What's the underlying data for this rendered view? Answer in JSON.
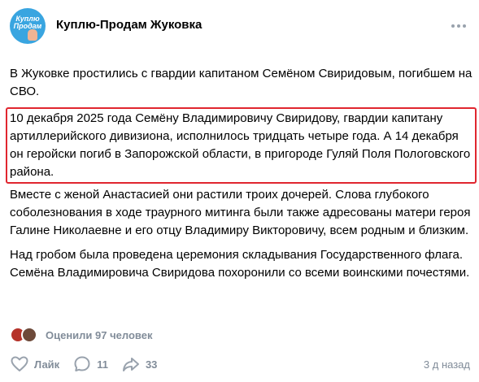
{
  "group": {
    "name": "Куплю-Продам Жуковка",
    "logo_text": [
      "Куплю",
      "Продам"
    ]
  },
  "post": {
    "intro": "В Жуковке простились с гвардии капитаном Семёном Свиридовым, погибшем на СВО.",
    "highlighted": "10 декабря 2025 года Семёну Владимировичу Свиридову, гвардии капитану артиллерийского дивизиона, исполнилось тридцать четыре года. А 14 декабря он геройски погиб в Запорожской области, в пригороде Гуляй Поля Пологовского района.",
    "para2": "Вместе с женой Анастасией они растили троих дочерей. Слова глубокого соболезнования в ходе траурного митинга были также адресованы матери героя Галине Николаевне и его отцу Владимиру Викторовичу, всем родным и близким.",
    "para3": "Над гробом была проведена церемония складывания Государственного флага. Семёна Владимировича Свиридова похоронили со всеми воинскими почестями."
  },
  "reactions": {
    "text": "Оценили 97 человек"
  },
  "actions": {
    "like_label": "Лайк",
    "comments_count": "11",
    "shares_count": "33",
    "timestamp": "3 д назад"
  },
  "colors": {
    "highlight_border": "#e0262f",
    "muted_text": "#818c99",
    "avatar_blue": "#39a5e0"
  }
}
